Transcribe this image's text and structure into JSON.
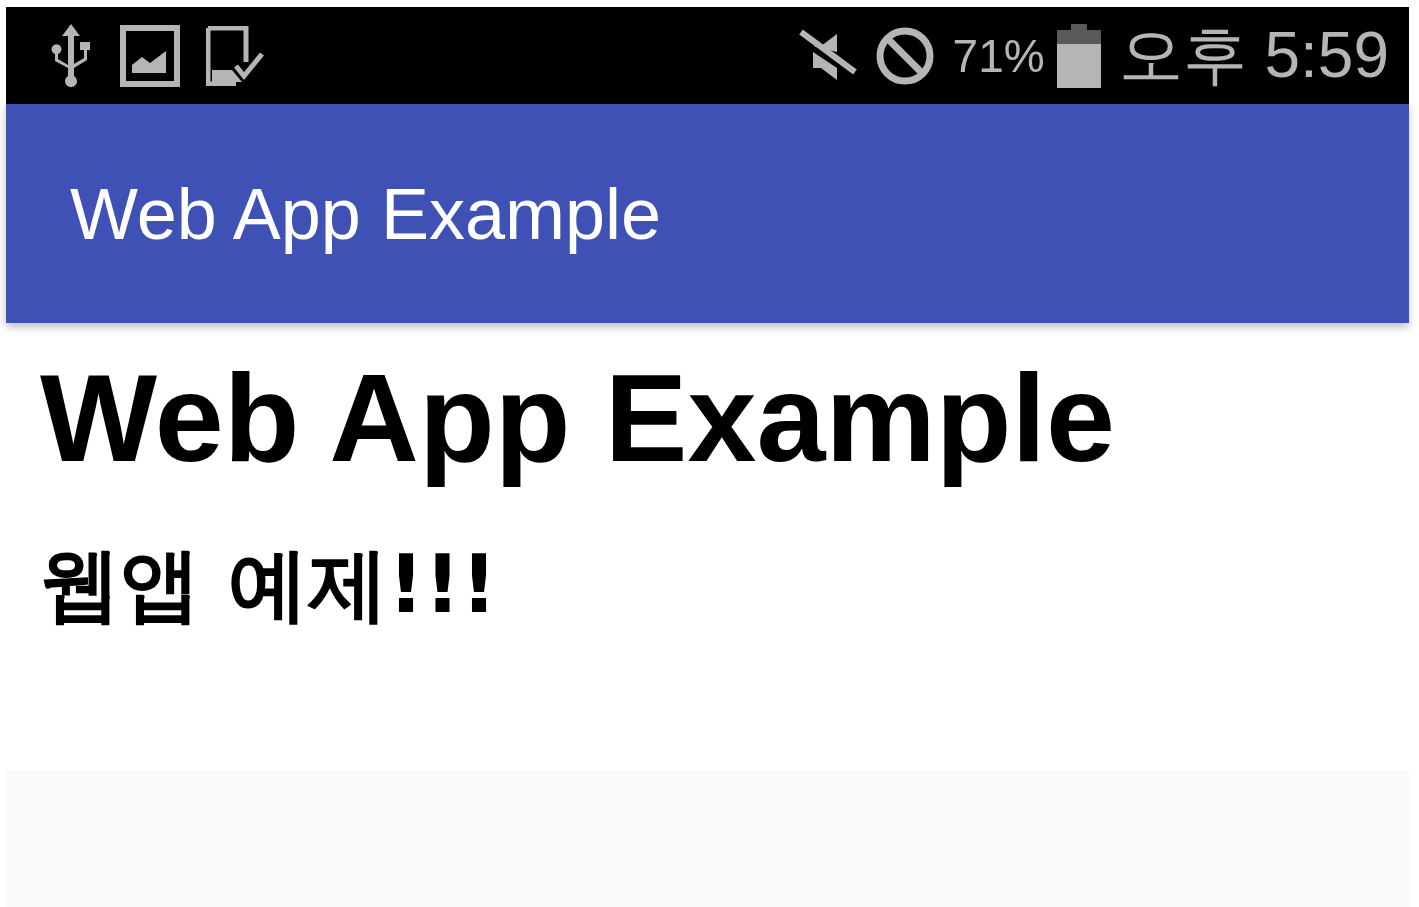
{
  "status_bar": {
    "battery_percent": "71%",
    "time": "오후 5:59"
  },
  "app_bar": {
    "title": "Web App Example"
  },
  "content": {
    "heading": "Web App Example",
    "subheading": "웹앱 예제!!!"
  }
}
